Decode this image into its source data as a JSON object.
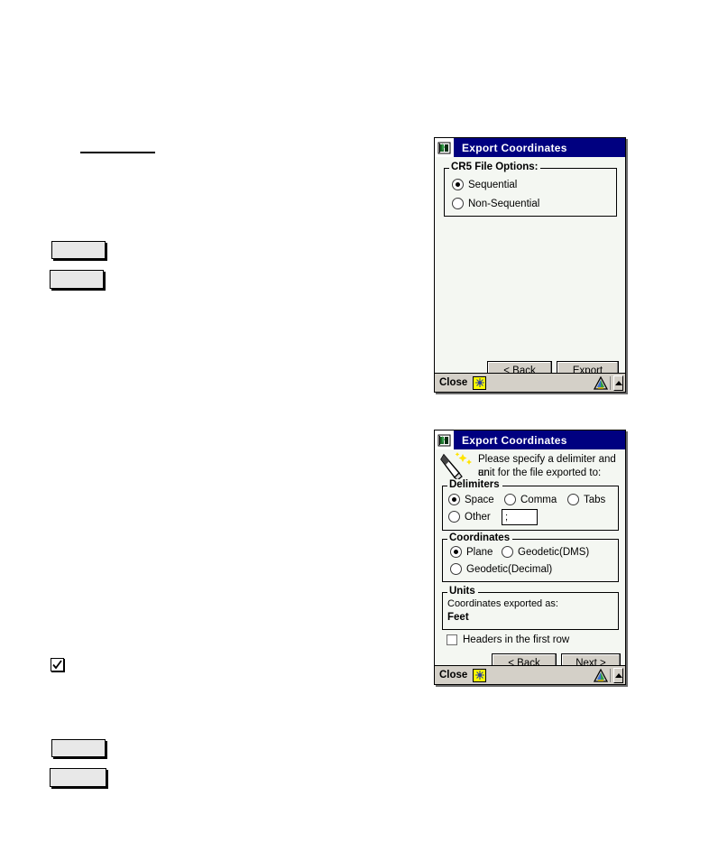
{
  "page": {
    "background": "#ffffff",
    "blank_elements": {
      "rule_label": "horizontal-rule",
      "box_label": "blank-field-box",
      "checkbox_label": "checked-checkbox"
    }
  },
  "theme": {
    "titlebar_bg": "#000080",
    "titlebar_text": "#ffffff",
    "dialog_bg": "#f4f7f2",
    "button_face": "#d4d0c8",
    "statusbar_bg": "#d4d0c8",
    "accent_yellow": "#ffff00",
    "border": "#000000"
  },
  "dialog1": {
    "title": "Export Coordinates",
    "icon": "app-window-icon",
    "group": {
      "legend": "CR5 File Options:",
      "options": [
        {
          "label": "Sequential",
          "selected": true
        },
        {
          "label": "Non-Sequential",
          "selected": false
        }
      ]
    },
    "buttons": [
      {
        "name": "back-button",
        "label": "< Back",
        "accel": "B"
      },
      {
        "name": "export-button",
        "label": "Export",
        "accel": "E"
      }
    ],
    "statusbar": {
      "close_label": "Close",
      "icons": [
        "keyboard-icon",
        "satellite-triangle-icon",
        "scroll-up-icon"
      ]
    }
  },
  "dialog2": {
    "title": "Export Coordinates",
    "icon": "app-window-icon",
    "instruction_icon": "stylus-wand-icon",
    "instruction_line1": "Please specify a delimiter and an",
    "instruction_line2": "unit for the file exported to:",
    "delimiters": {
      "legend": "Delimiters",
      "options": [
        {
          "label": "Space",
          "selected": true
        },
        {
          "label": "Comma",
          "selected": false
        },
        {
          "label": "Tabs",
          "selected": false
        },
        {
          "label": "Other",
          "selected": false
        }
      ],
      "other_value": ";",
      "other_placeholder": ""
    },
    "coordinates": {
      "legend": "Coordinates",
      "options": [
        {
          "label": "Plane",
          "selected": true
        },
        {
          "label": "Geodetic(DMS)",
          "selected": false
        },
        {
          "label": "Geodetic(Decimal)",
          "selected": false
        }
      ]
    },
    "units": {
      "legend": "Units",
      "caption": "Coordinates exported as:",
      "value": "Feet"
    },
    "headers_checkbox": {
      "label": "Headers in the first row",
      "checked": false
    },
    "buttons": [
      {
        "name": "back-button",
        "label": "< Back",
        "accel": "B"
      },
      {
        "name": "next-button",
        "label": "Next >",
        "accel": "N"
      }
    ],
    "statusbar": {
      "close_label": "Close",
      "icons": [
        "keyboard-icon",
        "satellite-triangle-icon",
        "scroll-up-icon"
      ]
    }
  }
}
